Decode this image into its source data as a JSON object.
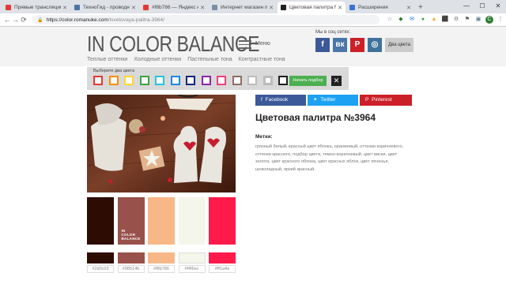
{
  "browser": {
    "tabs": [
      {
        "label": "Прямые трансляции -",
        "favicon_color": "#e53935",
        "active": false
      },
      {
        "label": "ТехноГид - проводни",
        "favicon_color": "#4a76a8",
        "active": false
      },
      {
        "label": "#f8b786 — Яндекс но",
        "favicon_color": "#e53935",
        "active": false
      },
      {
        "label": "Интернет магазин под",
        "favicon_color": "#7b8fa6",
        "active": false
      },
      {
        "label": "Цветовая палитра №3",
        "favicon_color": "#222222",
        "active": true
      },
      {
        "label": "Расширения",
        "favicon_color": "#3b73d6",
        "active": false
      }
    ],
    "new_tab": "+",
    "window_controls": [
      "—",
      "☐",
      "✕"
    ],
    "url_domain": "https://color.romanuke.com",
    "url_path": "/tsvetovaya-palitra-3964/",
    "nav": [
      "←",
      "→",
      "⟳"
    ],
    "extensions": [
      {
        "icon": "star-icon",
        "glyph": "☆",
        "color": "#666666"
      },
      {
        "icon": "ext-icon-1",
        "glyph": "◆",
        "color": "#2e7d32"
      },
      {
        "icon": "ext-icon-2",
        "glyph": "✉",
        "color": "#1976d2"
      },
      {
        "icon": "ext-icon-3",
        "glyph": "●",
        "color": "#43a047"
      },
      {
        "icon": "ext-icon-4",
        "glyph": "▲",
        "color": "#f9a825"
      },
      {
        "icon": "ext-icon-5",
        "glyph": "⬛",
        "color": "#333333"
      },
      {
        "icon": "ext-icon-6",
        "glyph": "⚙",
        "color": "#777777"
      },
      {
        "icon": "ext-icon-7",
        "glyph": "⚑",
        "color": "#555555"
      },
      {
        "icon": "ext-icon-8",
        "glyph": "▣",
        "color": "#607d8b"
      },
      {
        "icon": "avatar-icon",
        "glyph": "C",
        "color": "#2e7d32"
      },
      {
        "icon": "kebab-icon",
        "glyph": "⋮",
        "color": "#555555"
      }
    ]
  },
  "header": {
    "logo": "IN COLOR BALANCE",
    "menu_label": "Меню",
    "social_label": "Мы в соц сетях:",
    "social": [
      {
        "name": "facebook",
        "glyph": "f",
        "color": "#3b5998"
      },
      {
        "name": "vk",
        "glyph": "вк",
        "color": "#4a76a8"
      },
      {
        "name": "pinterest",
        "glyph": "P",
        "color": "#cb2027"
      },
      {
        "name": "instagram",
        "glyph": "◎",
        "color": "#3f729b"
      }
    ],
    "two_colors": "Два цвета",
    "subnav": [
      "Теплые оттенки",
      "Холодные оттенки",
      "Пастельные тона",
      "Контрастные тона"
    ]
  },
  "picker": {
    "label": "Выберите два цвета",
    "swatches": [
      "#e53935",
      "#fb8c00",
      "#fdd835",
      "#43a047",
      "#26c6da",
      "#1e88e5",
      "#1a237e",
      "#8e24aa",
      "#ec407a",
      "#8d6e63",
      "#bdbdbd",
      "#ffffff",
      "#212121"
    ],
    "selected_index": 11,
    "apply": "Начать подбор",
    "clear": "✕"
  },
  "palette": {
    "colors": [
      "#2d0c03",
      "#98514b",
      "#f8b786",
      "#f4f6ec",
      "#ff1a4a"
    ],
    "watermark": [
      "IN",
      "COLOR",
      "BALANCE"
    ]
  },
  "share": [
    {
      "label": "Facebook",
      "icon": "facebook-icon",
      "glyph": "f",
      "color": "#3b5998"
    },
    {
      "label": "Twitter",
      "icon": "twitter-icon",
      "glyph": "✦",
      "color": "#1da1f2"
    },
    {
      "label": "Pinterest",
      "icon": "pinterest-icon",
      "glyph": "P",
      "color": "#cb2027"
    }
  ],
  "page_title": "Цветовая палитра №3964",
  "tags_heading": "Метки:",
  "tags_text": "грязный белый, красный цвет яблока, оранжевый, оттенки коричневого, оттенки красного, подбор цвета, темно-коричневый, цвет виски, цвет золота, цвет красного яблока, цвет красных яблок, цвет печенья, шоколадный, яркий красный."
}
